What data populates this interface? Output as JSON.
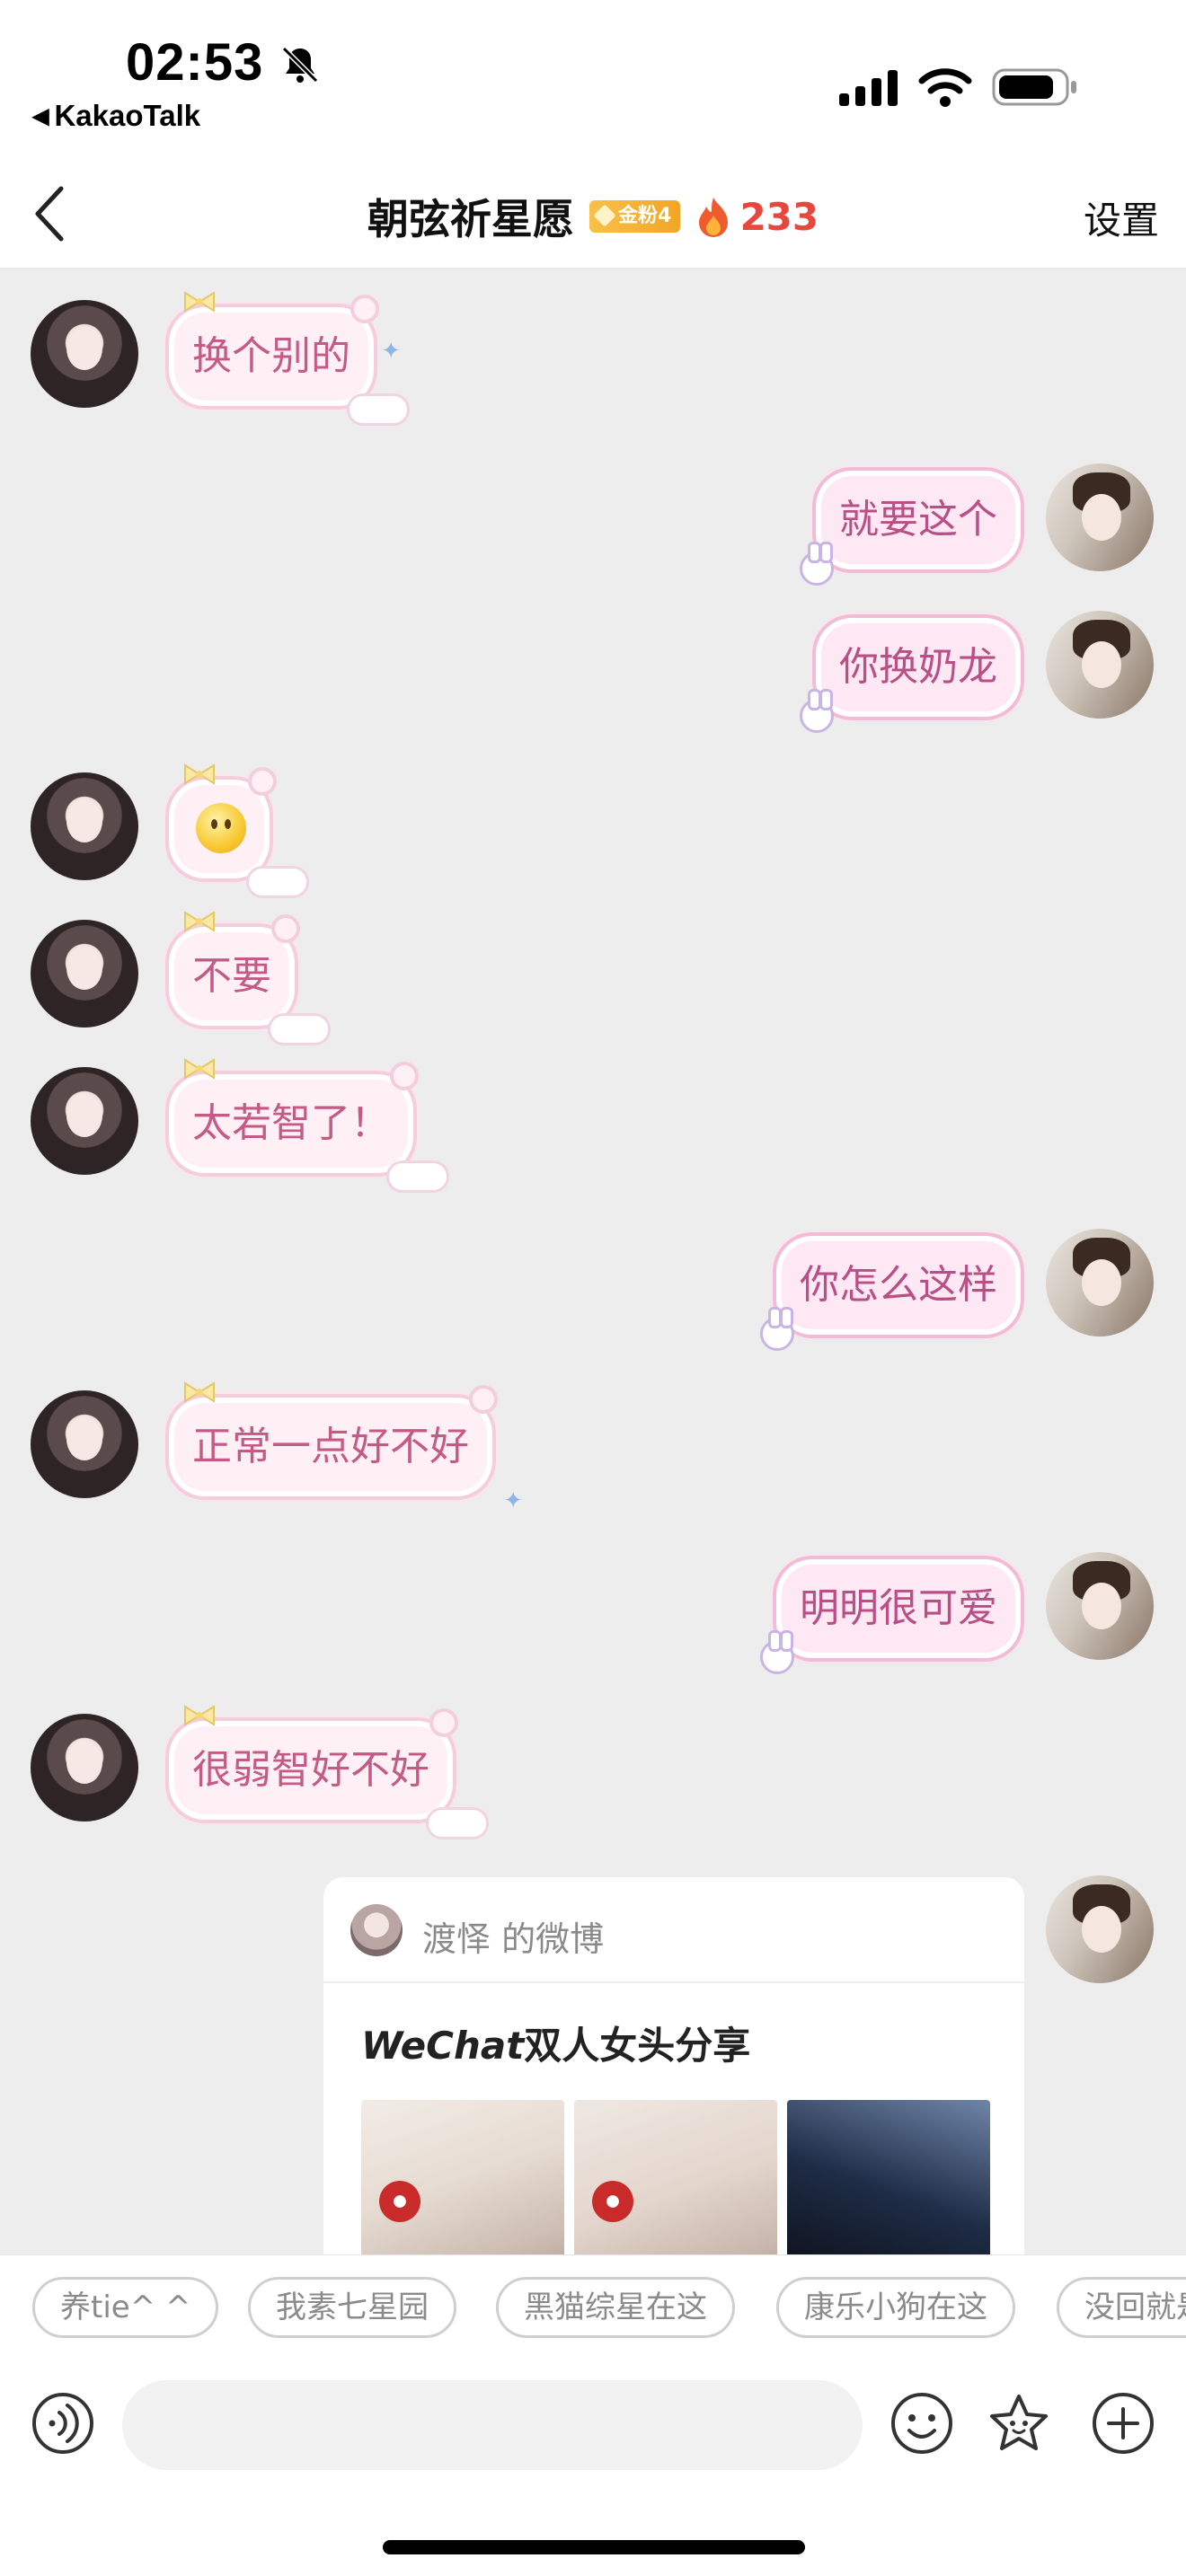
{
  "status_bar": {
    "time": "02:53",
    "back_app": "KakaoTalk",
    "icons": [
      "bell-off-icon",
      "signal-icon",
      "wifi-icon",
      "battery-icon"
    ]
  },
  "header": {
    "title": "朝弦祈星愿",
    "fan_badge": "金粉4",
    "streak": "233",
    "settings": "设置"
  },
  "messages": [
    {
      "side": "left",
      "text": "换个别的"
    },
    {
      "side": "right",
      "text": "就要这个"
    },
    {
      "side": "right",
      "text": "你换奶龙"
    },
    {
      "side": "left",
      "text": "",
      "emoji": "smile-emoji"
    },
    {
      "side": "left",
      "text": "不要"
    },
    {
      "side": "left",
      "text": "太若智了！"
    },
    {
      "side": "right",
      "text": "你怎么这样"
    },
    {
      "side": "left",
      "text": "正常一点好不好"
    },
    {
      "side": "right",
      "text": "明明很可爱"
    },
    {
      "side": "left",
      "text": "很弱智好不好"
    }
  ],
  "shared_card": {
    "source": "渡怿 的微博",
    "title_latin": "WeChat",
    "title_rest": "双人女头分享"
  },
  "quick_replies": [
    "养tie^ ^",
    "我素七星园",
    "黑猫综星在这",
    "康乐小狗在这",
    "没回就是"
  ],
  "input": {
    "placeholder": "",
    "value": ""
  },
  "colors": {
    "bubble_text": "#c45a85",
    "bubble_bg": "#fff0f5",
    "streak": "#e9463d",
    "background": "#ededed"
  }
}
